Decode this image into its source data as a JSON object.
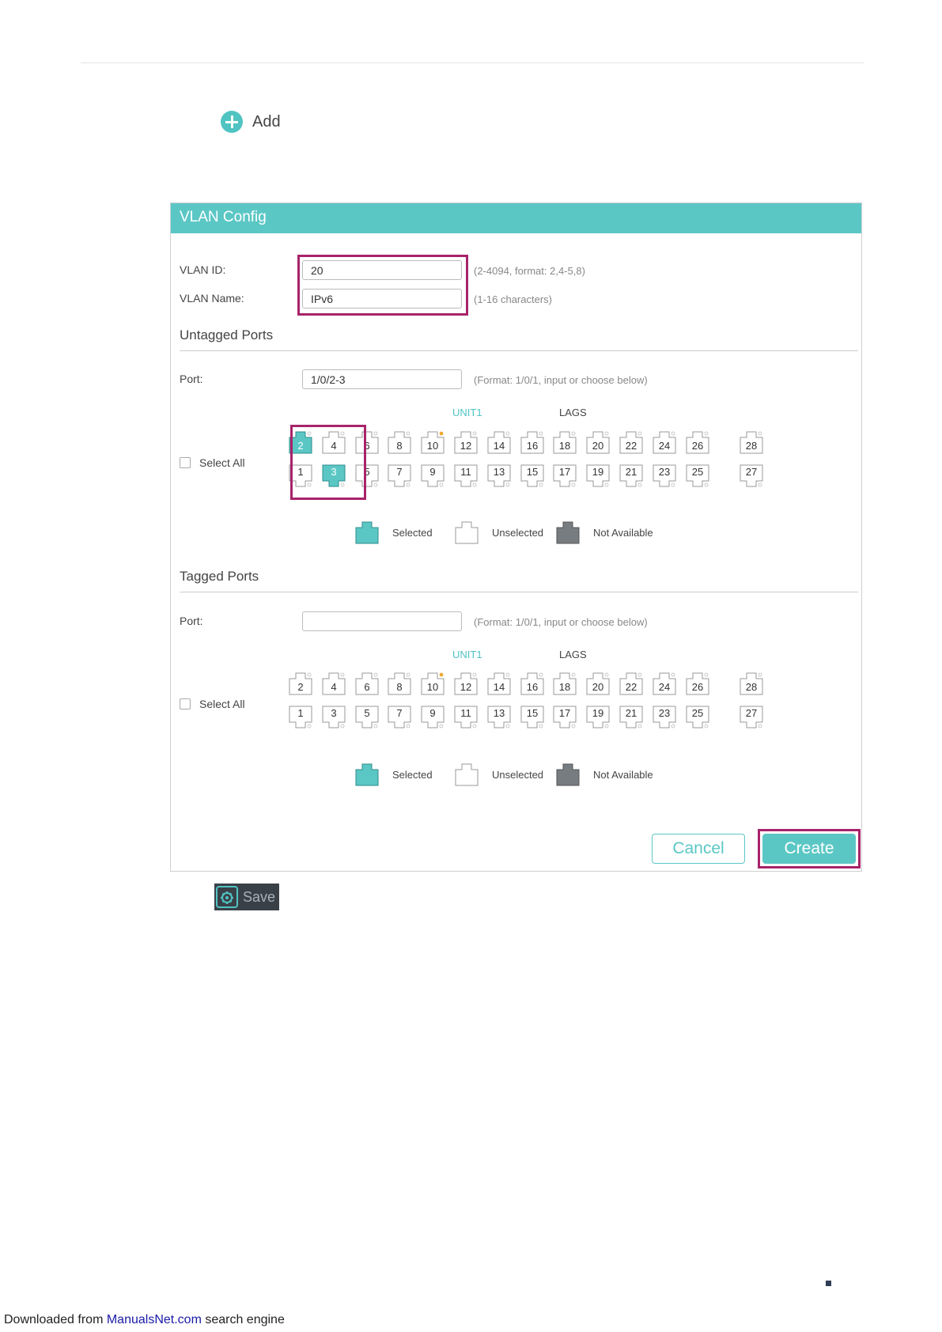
{
  "toolbar": {
    "add_label": "Add",
    "save_label": "Save"
  },
  "panel": {
    "title": "VLAN Config",
    "vlan_id": {
      "label": "VLAN ID:",
      "value": "20",
      "hint": "(2-4094, format: 2,4-5,8)"
    },
    "vlan_name": {
      "label": "VLAN Name:",
      "value": "IPv6",
      "hint": "(1-16 characters)"
    },
    "untagged": {
      "title": "Untagged Ports",
      "port_label": "Port:",
      "port_value": "1/0/2-3",
      "port_hint": "(Format: 1/0/1, input or choose below)",
      "unit_tab": "UNIT1",
      "lags_tab": "LAGS",
      "select_all": "Select All",
      "selected_ports": [
        "2",
        "3"
      ]
    },
    "tagged": {
      "title": "Tagged Ports",
      "port_label": "Port:",
      "port_value": "",
      "port_hint": "(Format: 1/0/1, input or choose below)",
      "unit_tab": "UNIT1",
      "lags_tab": "LAGS",
      "select_all": "Select All",
      "selected_ports": []
    },
    "ports_top": [
      "2",
      "4",
      "6",
      "8",
      "10",
      "12",
      "14",
      "16",
      "18",
      "20",
      "22",
      "24",
      "26",
      "28"
    ],
    "ports_bottom": [
      "1",
      "3",
      "5",
      "7",
      "9",
      "11",
      "13",
      "15",
      "17",
      "19",
      "21",
      "23",
      "25",
      "27"
    ],
    "active_port": "10",
    "legend": {
      "selected": "Selected",
      "unselected": "Unselected",
      "not_available": "Not Available"
    },
    "cancel_label": "Cancel",
    "create_label": "Create"
  },
  "footer": {
    "prefix": "Downloaded from ",
    "link": "ManualsNet.com",
    "suffix": " search engine"
  },
  "colors": {
    "accent": "#5bc7c5",
    "highlight": "#a8236a",
    "active_led": "#f0a830",
    "not_available": "#777c80"
  }
}
